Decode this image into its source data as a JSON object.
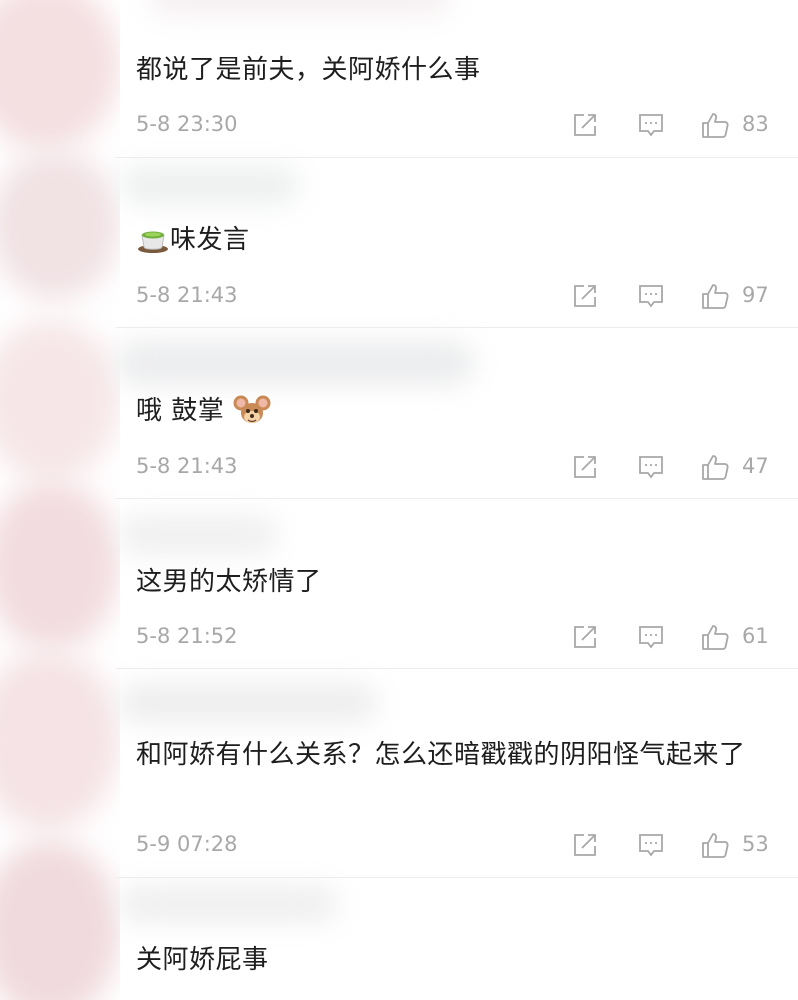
{
  "comments": [
    {
      "text": "都说了是前夫，关阿娇什么事",
      "time": "5-8 23:30",
      "likes": "83"
    },
    {
      "text": "味发言",
      "time": "5-8 21:43",
      "likes": "97",
      "leading_emoji": "tea-cup-emoji"
    },
    {
      "text": "哦 鼓掌",
      "time": "5-8 21:43",
      "likes": "47",
      "trailing_emoji": "jerry-mouse-emoji"
    },
    {
      "text": "这男的太矫情了",
      "time": "5-8 21:52",
      "likes": "61"
    },
    {
      "text": "和阿娇有什么关系？怎么还暗戳戳的阴阳怪气起来了",
      "time": "5-9 07:28",
      "likes": "53"
    },
    {
      "text": "关阿娇屁事"
    }
  ],
  "icons": {
    "share": "share-icon",
    "reply": "comment-icon",
    "like": "thumbs-up-icon"
  },
  "colors": {
    "text": "#1e1e1e",
    "meta": "#a8a8a8",
    "divider": "#ececec",
    "blurred_avatar": "#f3d9dc"
  }
}
